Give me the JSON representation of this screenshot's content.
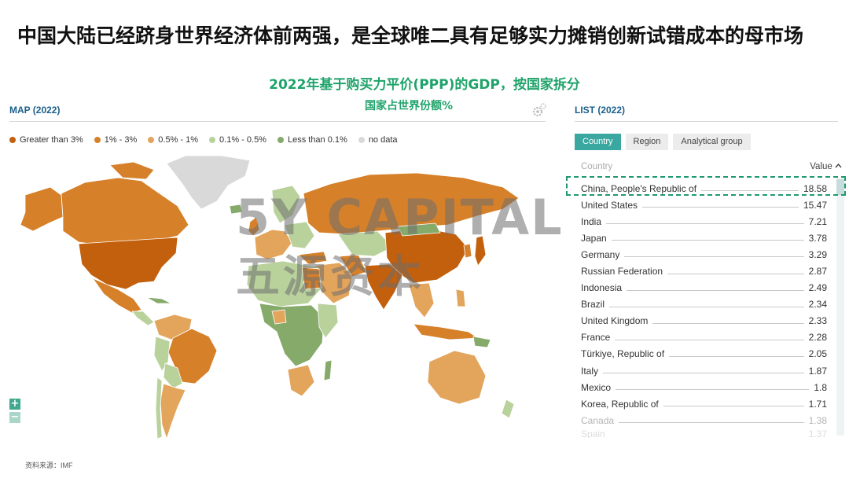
{
  "slide": {
    "title": "中国大陆已经跻身世界经济体前两强，是全球唯二具有足够实力摊销创新试错成本的母市场",
    "subtitle": "2022年基于购买力平价(PPP)的GDP，按国家拆分",
    "sub_subtitle": "国家占世界份额%",
    "source": "资料来源：IMF",
    "watermark_en": "5Y CAPITAL",
    "watermark_cn": "五源资本"
  },
  "map_panel": {
    "label": "MAP (2022)",
    "settings_icon": "gear-icon",
    "zoom_in_label": "+",
    "zoom_out_label": "−",
    "legend": [
      {
        "label": "Greater than 3%",
        "color": "#c2600e"
      },
      {
        "label": "1% - 3%",
        "color": "#d6802a"
      },
      {
        "label": "0.5% - 1%",
        "color": "#e3a45c"
      },
      {
        "label": "0.1% - 0.5%",
        "color": "#b9d29c"
      },
      {
        "label": "Less than 0.1%",
        "color": "#86aa6a"
      },
      {
        "label": "no data",
        "color": "#d9d9d9"
      }
    ]
  },
  "list_panel": {
    "label": "LIST (2022)",
    "tabs": [
      "Country",
      "Region",
      "Analytical group"
    ],
    "active_tab": "Country",
    "col_country": "Country",
    "col_value": "Value",
    "sort_icon": "chevron-up-icon",
    "rows": [
      {
        "name": "China, People's Republic of",
        "value": "18.58"
      },
      {
        "name": "United States",
        "value": "15.47"
      },
      {
        "name": "India",
        "value": "7.21"
      },
      {
        "name": "Japan",
        "value": "3.78"
      },
      {
        "name": "Germany",
        "value": "3.29"
      },
      {
        "name": "Russian Federation",
        "value": "2.87"
      },
      {
        "name": "Indonesia",
        "value": "2.49"
      },
      {
        "name": "Brazil",
        "value": "2.34"
      },
      {
        "name": "United Kingdom",
        "value": "2.33"
      },
      {
        "name": "France",
        "value": "2.28"
      },
      {
        "name": "Türkiye, Republic of",
        "value": "2.05"
      },
      {
        "name": "Italy",
        "value": "1.87"
      },
      {
        "name": "Mexico",
        "value": "1.8"
      },
      {
        "name": "Korea, Republic of",
        "value": "1.71"
      },
      {
        "name": "Canada",
        "value": "1.38"
      },
      {
        "name": "Spain",
        "value": "1.37"
      }
    ]
  }
}
